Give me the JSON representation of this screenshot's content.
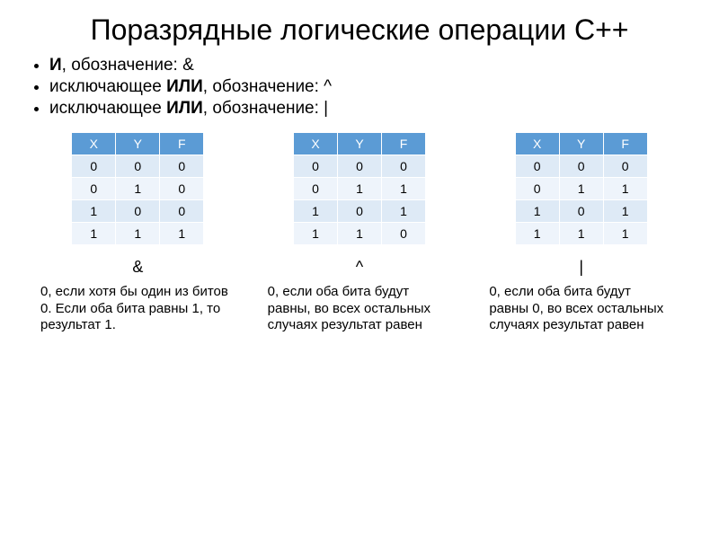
{
  "title": "Поразрядные логические операции С++",
  "bullets": [
    {
      "prefix": "И",
      "text": ", обозначение: &"
    },
    {
      "prefix": "исключающее",
      "bold": " ИЛИ",
      "text": ", обозначение:  ^"
    },
    {
      "prefix": "исключающее",
      "bold": " ИЛИ",
      "text": ", обозначение:  |"
    }
  ],
  "headers": {
    "x": "X",
    "y": "Y",
    "f": "F"
  },
  "tables": {
    "and": {
      "symbol": "&",
      "rows": [
        {
          "x": "0",
          "y": "0",
          "f": "0"
        },
        {
          "x": "0",
          "y": "1",
          "f": "0"
        },
        {
          "x": "1",
          "y": "0",
          "f": "0"
        },
        {
          "x": "1",
          "y": "1",
          "f": "1"
        }
      ],
      "desc": " 0, если хотя бы один из битов 0. Если оба бита равны 1, то результат 1."
    },
    "xor": {
      "symbol": "^",
      "rows": [
        {
          "x": "0",
          "y": "0",
          "f": "0"
        },
        {
          "x": "0",
          "y": "1",
          "f": "1"
        },
        {
          "x": "1",
          "y": "0",
          "f": "1"
        },
        {
          "x": "1",
          "y": "1",
          "f": "0"
        }
      ],
      "desc": "0, если оба бита будут равны, во всех остальных случаях результат равен"
    },
    "or": {
      "symbol": "|",
      "rows": [
        {
          "x": "0",
          "y": "0",
          "f": "0"
        },
        {
          "x": "0",
          "y": "1",
          "f": "1"
        },
        {
          "x": "1",
          "y": "0",
          "f": "1"
        },
        {
          "x": "1",
          "y": "1",
          "f": "1"
        }
      ],
      "desc": "0, если оба бита будут равны 0, во всех остальных случаях результат равен"
    }
  }
}
